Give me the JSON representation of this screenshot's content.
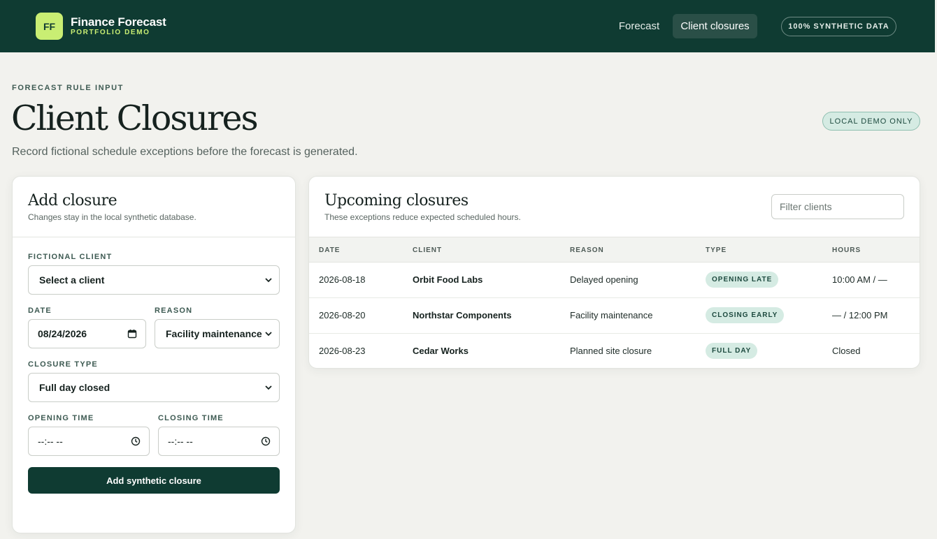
{
  "header": {
    "logo_text": "FF",
    "brand_name": "Finance Forecast",
    "brand_sub": "PORTFOLIO DEMO",
    "nav": [
      {
        "label": "Forecast"
      },
      {
        "label": "Client closures",
        "active": true
      }
    ],
    "badge": "100% SYNTHETIC DATA"
  },
  "page": {
    "eyebrow": "FORECAST RULE INPUT",
    "title": "Client Closures",
    "subtitle": "Record fictional schedule exceptions before the forecast is generated.",
    "badge": "LOCAL DEMO ONLY"
  },
  "add_closure": {
    "title": "Add closure",
    "subtitle": "Changes stay in the local synthetic database.",
    "client": {
      "label": "FICTIONAL CLIENT",
      "value": "Select a client"
    },
    "date": {
      "label": "DATE",
      "value": "08/24/2026"
    },
    "reason": {
      "label": "REASON",
      "value": "Facility maintenance"
    },
    "closure_type": {
      "label": "CLOSURE TYPE",
      "value": "Full day closed"
    },
    "opening_time": {
      "label": "OPENING TIME",
      "value": "--:-- --"
    },
    "closing_time": {
      "label": "CLOSING TIME",
      "value": "--:-- --"
    },
    "submit_label": "Add synthetic closure"
  },
  "upcoming": {
    "title": "Upcoming closures",
    "subtitle": "These exceptions reduce expected scheduled hours.",
    "filter_placeholder": "Filter clients",
    "columns": [
      "DATE",
      "CLIENT",
      "REASON",
      "TYPE",
      "HOURS"
    ],
    "rows": [
      {
        "date": "2026-08-18",
        "client": "Orbit Food Labs",
        "reason": "Delayed opening",
        "type": "OPENING LATE",
        "hours": "10:00 AM / —"
      },
      {
        "date": "2026-08-20",
        "client": "Northstar Components",
        "reason": "Facility maintenance",
        "type": "CLOSING EARLY",
        "hours": "— / 12:00 PM"
      },
      {
        "date": "2026-08-23",
        "client": "Cedar Works",
        "reason": "Planned site closure",
        "type": "FULL DAY",
        "hours": "Closed"
      }
    ]
  },
  "colors": {
    "header_bg": "#0f3b32",
    "accent_lime": "#c9ee73",
    "pill_bg": "#d5ebe3",
    "page_bg": "#f2f2ee"
  }
}
